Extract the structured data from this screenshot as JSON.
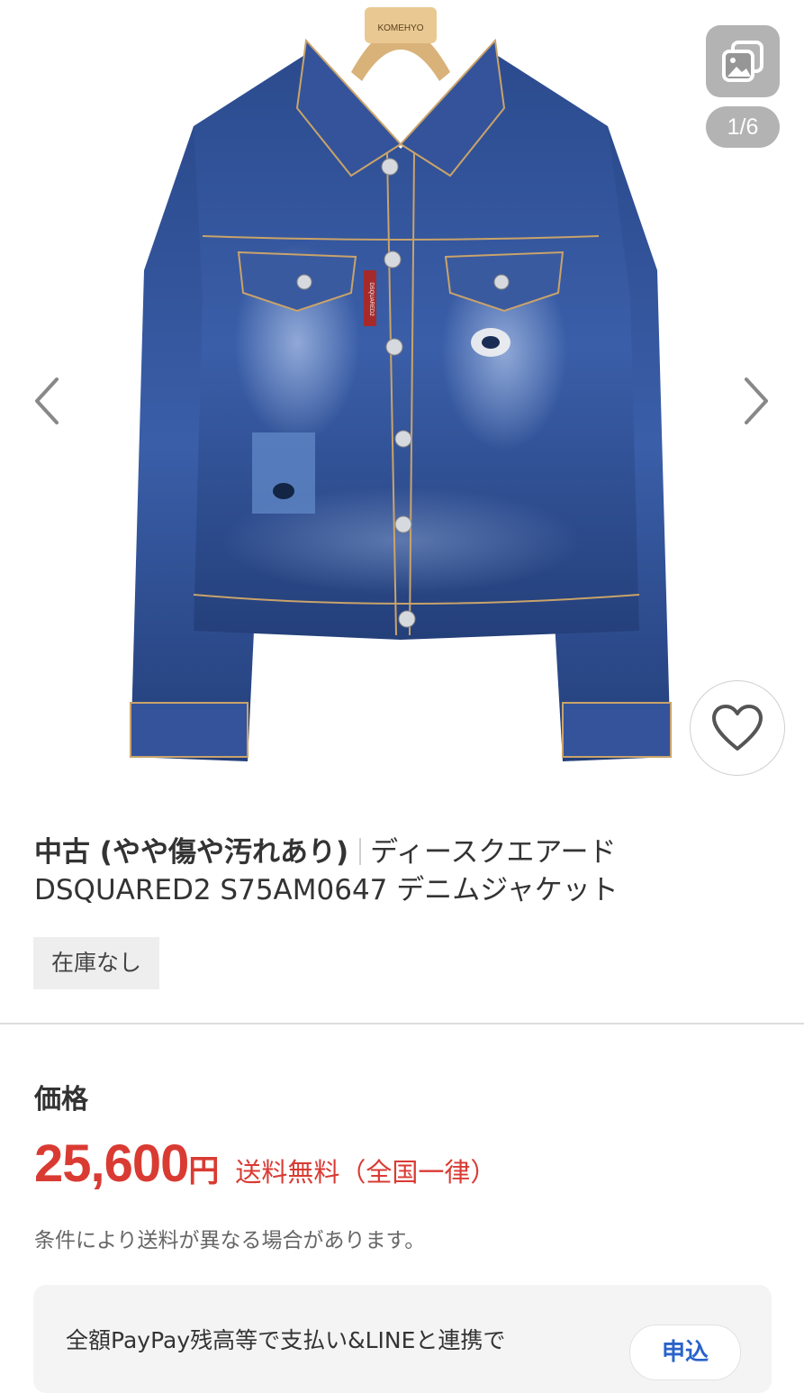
{
  "gallery": {
    "counter": "1/6",
    "photo_tag_text": "KOMEHYO",
    "label_text": "DSQUARED2",
    "icons": {
      "gallery": "image-gallery-icon",
      "prev": "chevron-left-icon",
      "next": "chevron-right-icon",
      "favorite": "heart-icon"
    }
  },
  "product": {
    "condition": "中古 (やや傷や汚れあり)",
    "title": "ディースクエアード DSQUARED2 S75AM0647 デニムジャケット",
    "stock": "在庫なし"
  },
  "price": {
    "label": "価格",
    "value": "25,600",
    "currency": "円",
    "shipping": "送料無料（全国一律）",
    "note": "条件により送料が異なる場合があります。"
  },
  "promo": {
    "text": "全額PayPay残高等で支払い&LINEと連携で",
    "button_label": "申込"
  },
  "colors": {
    "price_red": "#d93b33",
    "denim": "#2b4a8c",
    "link_blue": "#2a62c9"
  }
}
